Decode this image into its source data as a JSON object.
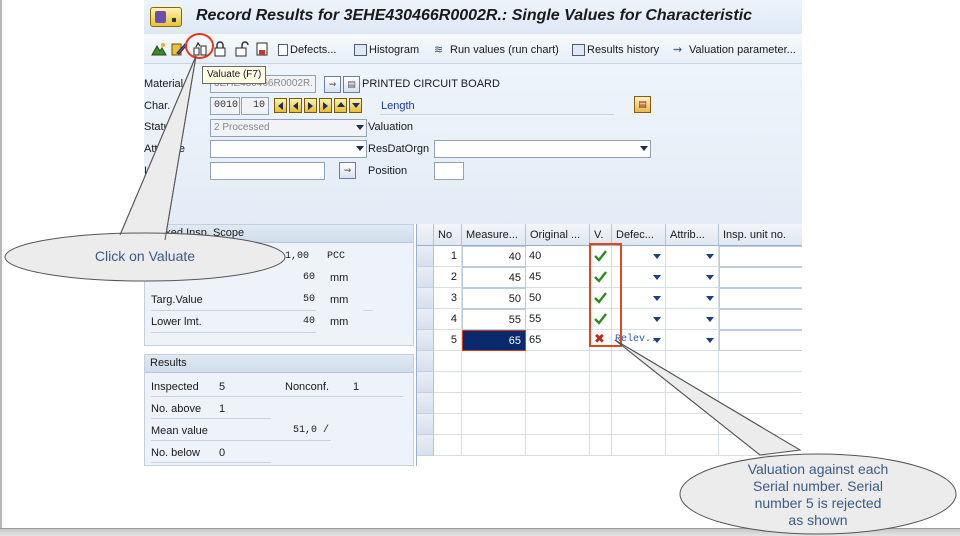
{
  "window": {
    "title": "Record Results for 3EHE430466R0002R.: Single Values for Characteristic"
  },
  "toolbar": {
    "defects_label": "Defects...",
    "histogram_label": "Histogram",
    "run_values_label": "Run values (run chart)",
    "results_history_label": "Results history",
    "valuation_param_label": "Valuation parameter..."
  },
  "tooltip": {
    "text": "Valuate  (F7)"
  },
  "form": {
    "material_label": "Material",
    "material_value": "3EHE430466R0002R.",
    "material_desc": "PRINTED CIRCUIT BOARD",
    "char_label": "Char.",
    "char_value": "0010",
    "char_index": "10",
    "char_desc": "Length",
    "status_label": "Status",
    "status_value": "2 Processed",
    "valuation_label": "Valuation",
    "attribute_label": "Attribute",
    "attribute_value": "",
    "resdatorgn_label": "ResDatOrgn",
    "resdatorgn_value": "",
    "info_label": "Info",
    "info_value": "",
    "position_label": "Position",
    "position_value": ""
  },
  "spec_panel": {
    "header": ": Fixed Insp. Scope",
    "sample_value": "1,00",
    "sample_unit": "PCC",
    "upper_value": "60",
    "upper_unit": "mm",
    "target_label": "Targ.Value",
    "target_value": "50",
    "target_unit": "mm",
    "lower_label": "Lower lmt.",
    "lower_value": "40",
    "lower_unit": "mm"
  },
  "results_panel": {
    "header": "Results",
    "inspected_label": "Inspected",
    "inspected_value": "5",
    "nonconf_label": "Nonconf.",
    "nonconf_value": "1",
    "no_above_label": "No. above",
    "no_above_value": "1",
    "mean_label": "Mean value",
    "mean_value": "51,0 /",
    "no_below_label": "No. below",
    "no_below_value": "0"
  },
  "grid": {
    "columns": [
      "No",
      "Measure...",
      "Original ...",
      "V.",
      "Defec...",
      "Attrib...",
      "Insp. unit no."
    ],
    "rows": [
      {
        "no": "1",
        "measure": "40",
        "original": "40",
        "valuation": "accepted",
        "defect": ""
      },
      {
        "no": "2",
        "measure": "45",
        "original": "45",
        "valuation": "accepted",
        "defect": ""
      },
      {
        "no": "3",
        "measure": "50",
        "original": "50",
        "valuation": "accepted",
        "defect": ""
      },
      {
        "no": "4",
        "measure": "55",
        "original": "55",
        "valuation": "accepted",
        "defect": ""
      },
      {
        "no": "5",
        "measure": "65",
        "original": "65",
        "valuation": "rejected",
        "defect": "Relev.."
      }
    ]
  },
  "callouts": {
    "valuate": "Click on Valuate",
    "valuation_line1": "Valuation against each",
    "valuation_line2": "Serial number. Serial",
    "valuation_line3": "number 5 is rejected",
    "valuation_line4": "as shown"
  },
  "colors": {
    "accepted": "#2e8b1e",
    "rejected": "#c0281e",
    "annotation": "#e04a1a",
    "selection": "#0a2a6e"
  }
}
